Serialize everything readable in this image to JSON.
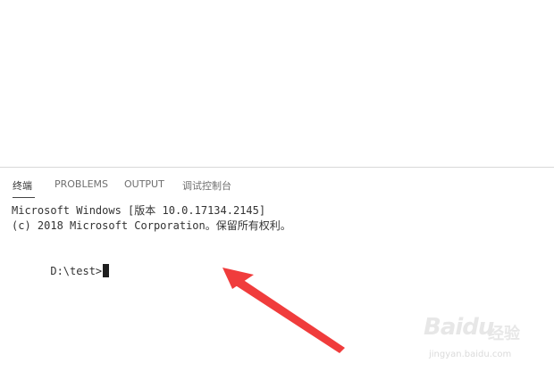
{
  "panel": {
    "tabs": [
      {
        "label": "终端",
        "active": true
      },
      {
        "label": "PROBLEMS",
        "active": false
      },
      {
        "label": "OUTPUT",
        "active": false
      },
      {
        "label": "调试控制台",
        "active": false
      }
    ]
  },
  "terminal": {
    "lines": [
      "Microsoft Windows [版本 10.0.17134.2145]",
      "(c) 2018 Microsoft Corporation。保留所有权利。"
    ],
    "prompt": "D:\\test>"
  },
  "annotation": {
    "arrow_color": "#f03c3c"
  },
  "watermark": {
    "logo": "Baidu",
    "cn": "经验",
    "url": "jingyan.baidu.com"
  },
  "colors": {
    "background": "#ffffff",
    "divider": "#d8d8d8",
    "text": "#333333",
    "tab_inactive": "#6f6f6f"
  }
}
